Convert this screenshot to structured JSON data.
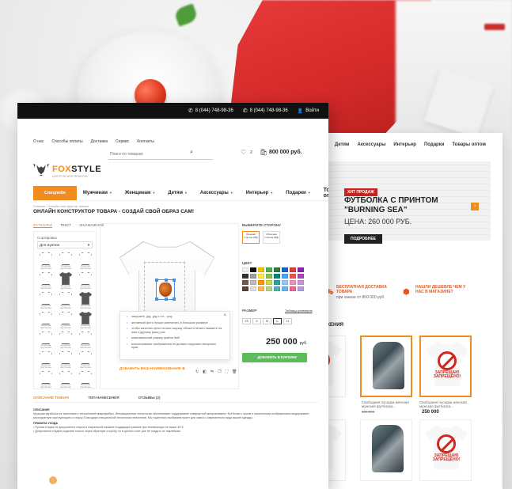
{
  "topbar": {
    "phone1": "8 (044) 748-98-36",
    "phone2": "8 (044) 748-98-36",
    "login": "Войти"
  },
  "toplinks": [
    "О нас",
    "Способы оплаты",
    "Доставка",
    "Сервис",
    "Контакты"
  ],
  "search": {
    "placeholder": "Поиск по товарам"
  },
  "cart": {
    "count": "2",
    "total": "800 000 руб."
  },
  "logo": {
    "brand_a": "FOX",
    "brand_b": "STYLE",
    "tagline": "ЦЕНТР ПЕЧАТИ ПРИНТОВ"
  },
  "nav": {
    "first": "Спецпейн",
    "items": [
      "Мужчинам",
      "Женщинам",
      "Детям",
      "Аксессуары",
      "Интерьер",
      "Подарки"
    ],
    "last": "Товары оптом"
  },
  "breadcrumb": "Главная  /  Онлайн конструктор товара",
  "page_title": "ОНЛАЙН КОНСТРУКТОР ТОВАРА - СОЗДАЙ СВОЙ ОБРАЗ САМ!",
  "side_tabs": [
    "ФУТБОЛКИ",
    "ТЕКСТ",
    "ЗНАЧКАЖНОЕ"
  ],
  "side_panel": {
    "sort_label": "Сортировка",
    "sort_value": "Для мужчин",
    "thumb_label": "Мужская футболка"
  },
  "tooltip": {
    "items": [
      "загрузите .jpg, .jpg и.т.п., .png",
      "желаемой фото лучше запечатать в большом размере",
      "чтобы качество фото на всю широку области печати нажмите на нем к другому (ваш) раз",
      "максимальный размер файла 5мб",
      "использование изображения не должно нарушать авторских прав"
    ]
  },
  "add_text_link": "ДОБАВИТЬ ВАШ НАИМЕНОВАНИЕ",
  "right_panel": {
    "side_label": "ВЫБЕРИТЕ СТОРОНУ",
    "side_front": "Лицевая сторона (ИД)",
    "side_back": "Обратная сторона (ИД)",
    "color_label": "ЦВЕТ",
    "size_label": "РАЗМЕР",
    "size_table": "Таблица размеров",
    "sizes": [
      "XS",
      "S",
      "M",
      "L",
      "XL"
    ],
    "price": "250 000",
    "currency": "руб.",
    "add_to_cart": "ДОБАВИТЬ В КОРЗИНУ",
    "colors": [
      "#f2f2f2",
      "#111111",
      "#f2c200",
      "#4caf50",
      "#2e7d32",
      "#1565c0",
      "#e53935",
      "#8e24aa",
      "#333333",
      "#9e9e9e",
      "#ffeb3b",
      "#8bc34a",
      "#00897b",
      "#42a5f5",
      "#ef5350",
      "#ab47bc",
      "#795548",
      "#bdbdbd",
      "#ff9800",
      "#cddc39",
      "#26a69a",
      "#90caf9",
      "#f48fb1",
      "#ce93d8",
      "#5d4037",
      "#e0e0e0",
      "#ffb74d",
      "#aed581",
      "#4db6ac",
      "#64b5f6",
      "#f06292",
      "#b39ddb"
    ]
  },
  "desc_tabs": [
    "ОПИСАНИЕ ТОВАРА",
    "ТИП НАНЕСЕНИЯ",
    "ОТЗЫВЫ (2)"
  ],
  "desc": {
    "heading1": "ОПИСАНИЕ",
    "text1": "Мужская футболка из трикотажа с технологией микрофибры. Инновационная технология обеспечивает поддержание комфортной микроклимата. Футболка с кроем и нанесенным изображением выдерживает многократную эксплуатацию и стирку. Благодаря специальной технологии нанесения. Мы тщательно выбираем принт для самого современного вида вашей одежды.",
    "heading2": "ПРАВИЛА УХОДА",
    "rule1": "Ручная стирка не допускается стирка в стиральной машине в щадящем режиме при температуре не выше 40°С",
    "rule2": "Допускается гладить изделие только через обратную сторону, но в целом стоит уже не гладить по наклейкам"
  },
  "back_page": {
    "nav": [
      "Детям",
      "Аксессуары",
      "Интерьер",
      "Подарки",
      "Товары оптом"
    ],
    "badge": "ХИТ ПРОДАЖ",
    "title": "ФУТБОЛКА С ПРИНТОМ \"BURNING SEA\"",
    "price": "ЦЕНА: 260 000 РУБ.",
    "button": "ПОДРОБНЕЕ",
    "feature1": "БЕСПЛАТНАЯ ДОСТАВКА ТОВАРА",
    "feature1_sub": "при заказе от 800 000 руб.",
    "feature2": "НАШЛИ ДЕШЕВЛЕ ЧЕМ У НАС В МАГАЗИНЕ?",
    "section": "ОЖЕНИЯ",
    "card_sign": "ЗАПРЕЩАЮ ЗАПРЕЩЕНО!",
    "card_desc": "Свободная посадка женская мужская футболка...",
    "card_price": "250 000",
    "card_old": "300 000"
  }
}
